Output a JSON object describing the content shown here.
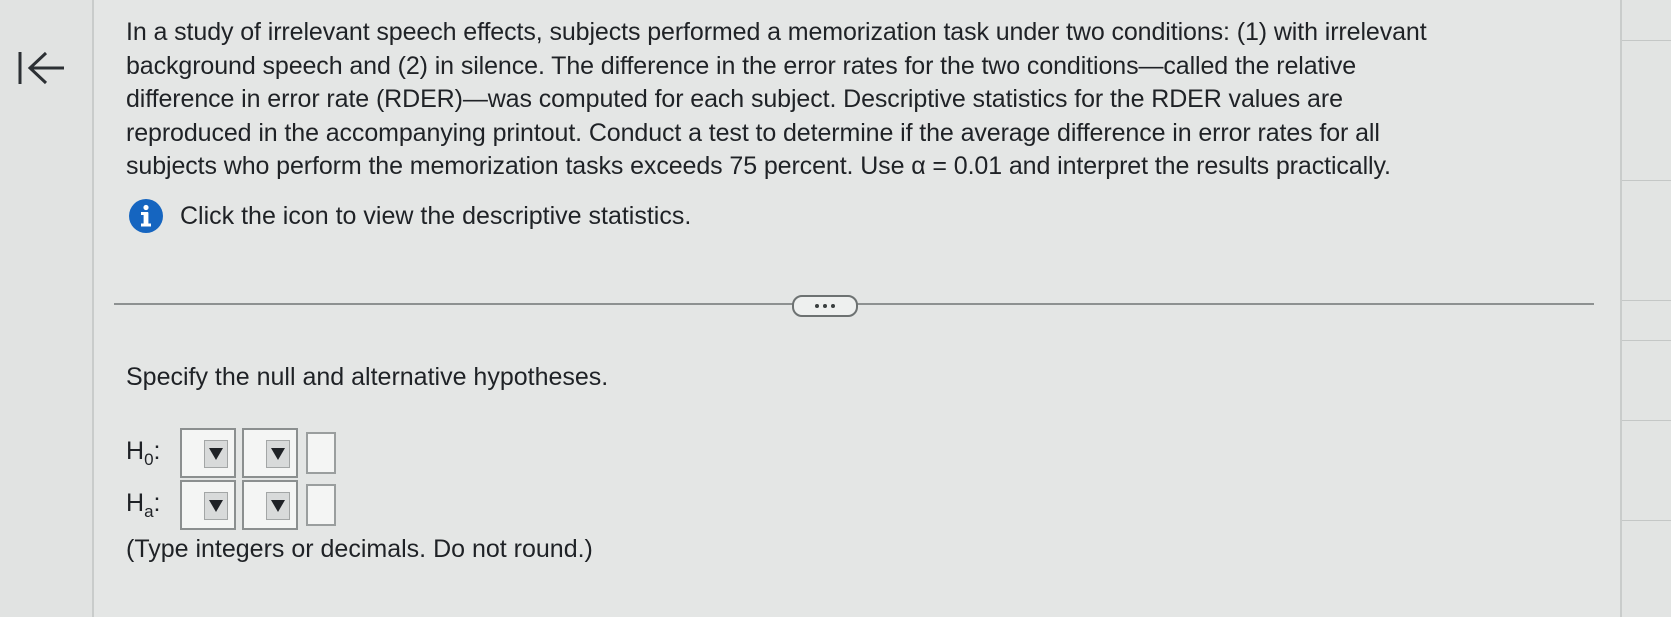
{
  "nav": {
    "collapse_icon": "collapse-left-arrow-icon"
  },
  "problem": {
    "lines": [
      "In a study of irrelevant speech effects, subjects performed a memorization task under two conditions: (1) with irrelevant",
      "background speech and (2) in silence. The difference in the error rates for the two conditions—called the relative",
      "difference in error rate (RDER)—was computed for each subject. Descriptive statistics for the RDER values are",
      "reproduced in the accompanying printout. Conduct a test to determine if the average difference in error rates for all",
      "subjects who perform the memorization tasks exceeds 75 percent. Use α = 0.01 and interpret the results practically."
    ],
    "info_text": "Click the icon to view the descriptive statistics.",
    "info_icon": "info-icon",
    "info_icon_color": "#1565c0"
  },
  "divider": {
    "more_icon": "ellipsis-icon"
  },
  "question": {
    "prompt": "Specify the null and alternative hypotheses.",
    "h0": {
      "symbol": "H",
      "subscript": "0",
      "suffix": ":",
      "value": ""
    },
    "ha": {
      "symbol": "H",
      "subscript": "a",
      "suffix": ":",
      "value": ""
    },
    "note": "(Type integers or decimals. Do not round.)"
  },
  "colors": {
    "background": "#e4e6e5",
    "text": "#1f2226",
    "accent": "#1565c0"
  }
}
